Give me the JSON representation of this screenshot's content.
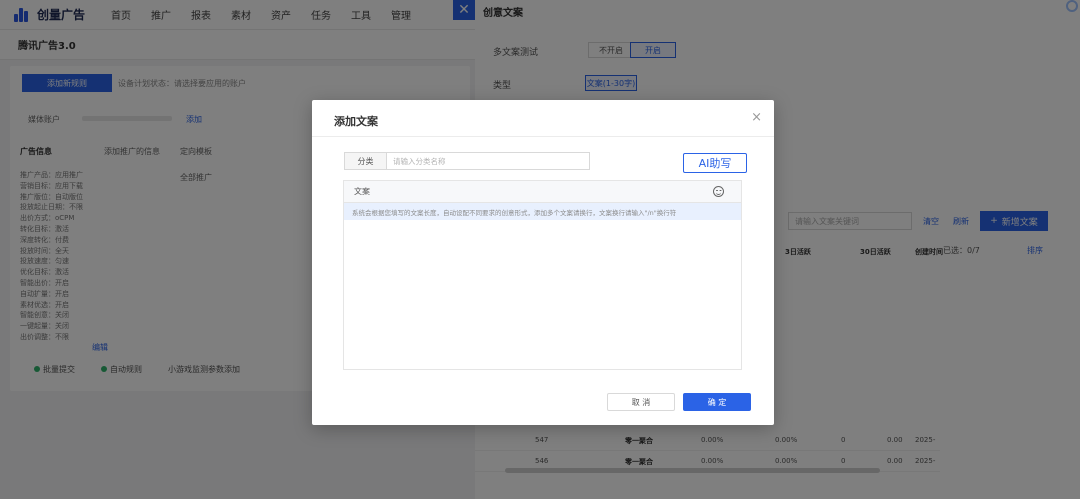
{
  "app": {
    "logo_text": "创量广告",
    "nav": [
      "首页",
      "推广",
      "报表",
      "素材",
      "资产",
      "任务",
      "工具",
      "管理"
    ],
    "subheader_title": "腾讯广告3.0"
  },
  "left": {
    "primary_button": "添加新规则",
    "hint": "设备计划状态：请选择要应用的账户",
    "account_label": "媒体账户",
    "account_link": "添加",
    "section_label": "广告信息",
    "section_hint": "添加推广的信息",
    "right_label": "定向模板",
    "option_label": "全部推广",
    "details": [
      "推广产品：应用推广",
      "营销目标：应用下载",
      "推广版位：自动版位",
      "投放起止日期：不限",
      "出价方式：oCPM",
      "转化目标：激活",
      "深度转化：付费",
      "投放时间：全天",
      "投放速度：匀速",
      "优化目标：激活",
      "智能出价：开启",
      "自动扩量：开启",
      "素材优选：开启",
      "智能创意：关闭",
      "一键起量：关闭",
      "出价调整：不限"
    ],
    "footer_opts": [
      "批量提交",
      "自动规则",
      "小游戏监测参数添加"
    ],
    "edit_link": "编辑"
  },
  "drawer": {
    "title": "创意文案",
    "multi_copy_label": "多文案测试",
    "multi_off": "不开启",
    "multi_on": "开启",
    "type_label": "类型",
    "type_value": "文案(1-30字)",
    "search_placeholder": "请输入文案关键词",
    "link_clear": "清空",
    "link_refresh": "刷新",
    "new_copy": "新增文案",
    "selected": "已选：0/7",
    "sort": "排序",
    "table_headers": [
      "3日活跃",
      "3日活跃",
      "30日活跃",
      "创建时间"
    ],
    "row_template": {
      "pct": "0.00%",
      "num": "0",
      "val": "0.00",
      "date": "2025-"
    },
    "bottom_rows": [
      {
        "id": "547",
        "name": "零一聚合",
        "pct": "0.00%"
      },
      {
        "id": "546",
        "name": "零一聚合",
        "pct": "0.00%"
      }
    ]
  },
  "modal": {
    "title": "添加文案",
    "close_symbol": "×",
    "category_label": "分类",
    "category_placeholder": "请输入分类名称",
    "ai_button": "AI助写",
    "copy_header": "文案",
    "copy_hint": "系统会根据您填写的文案长度，自动设配不同要求的创意形式，添加多个文案请换行，文案换行请输入\"/n\"换行符",
    "cancel": "取 消",
    "confirm": "确 定"
  },
  "colors": {
    "accent": "#2b63e6",
    "overlay": "rgba(0,0,0,0.5)"
  }
}
